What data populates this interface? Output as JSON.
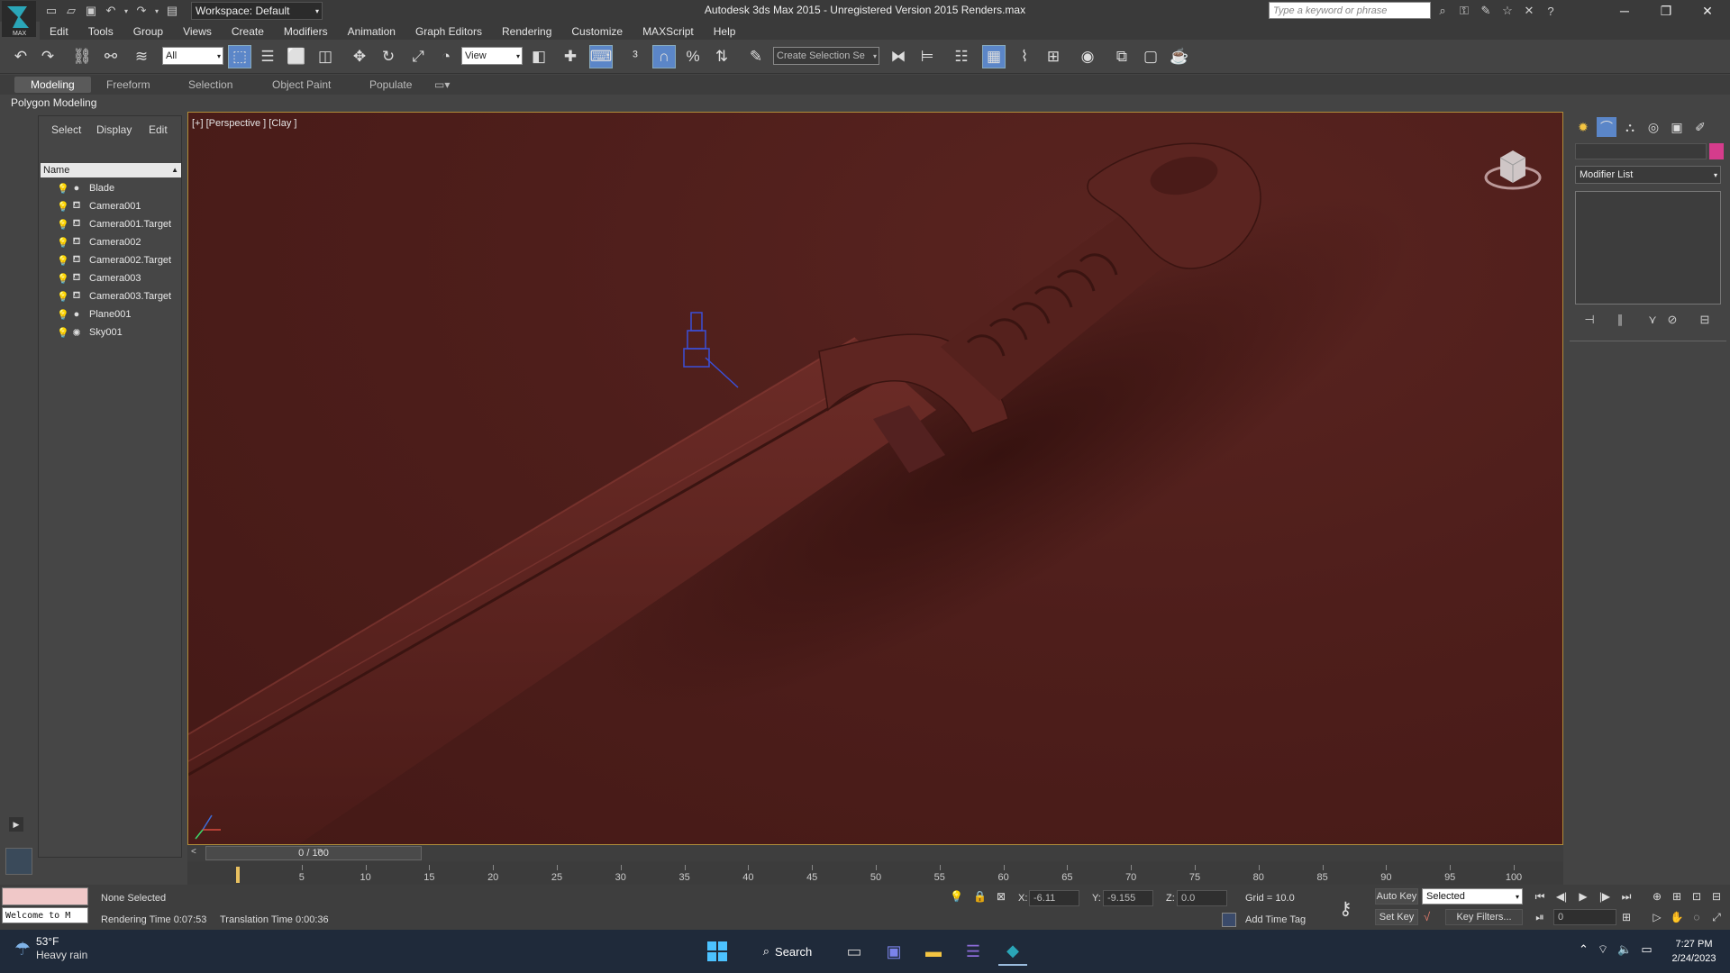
{
  "titlebar": {
    "workspace": "Workspace: Default",
    "window_title": "Autodesk 3ds Max  2015  -  Unregistered Version   2015 Renders.max",
    "search_placeholder": "Type a keyword or phrase"
  },
  "menu": [
    "Edit",
    "Tools",
    "Group",
    "Views",
    "Create",
    "Modifiers",
    "Animation",
    "Graph Editors",
    "Rendering",
    "Customize",
    "MAXScript",
    "Help"
  ],
  "toolbar": {
    "filter_value": "All",
    "reference_coord": "View",
    "selection_set": "Create Selection Se"
  },
  "ribbon": {
    "tabs": [
      "Modeling",
      "Freeform",
      "Selection",
      "Object Paint",
      "Populate"
    ],
    "sub_label": "Polygon Modeling"
  },
  "explorer": {
    "tabs": [
      "Select",
      "Display",
      "Edit"
    ],
    "column_header": "Name",
    "objects": [
      {
        "name": "Blade",
        "type": "sphere"
      },
      {
        "name": "Camera001",
        "type": "camera"
      },
      {
        "name": "Camera001.Target",
        "type": "camera"
      },
      {
        "name": "Camera002",
        "type": "camera"
      },
      {
        "name": "Camera002.Target",
        "type": "camera"
      },
      {
        "name": "Camera003",
        "type": "camera"
      },
      {
        "name": "Camera003.Target",
        "type": "camera"
      },
      {
        "name": "Plane001",
        "type": "sphere"
      },
      {
        "name": "Sky001",
        "type": "light"
      }
    ]
  },
  "viewport": {
    "label": "[+] [Perspective ] [Clay ]"
  },
  "command_panel": {
    "modifier_list": "Modifier List",
    "color": "#d53c8c"
  },
  "timeline": {
    "slider_label": "0 / 100",
    "ticks": [
      "5",
      "10",
      "15",
      "20",
      "25",
      "30",
      "35",
      "40",
      "45",
      "50",
      "55",
      "60",
      "65",
      "70",
      "75",
      "80",
      "85",
      "90",
      "95",
      "100"
    ]
  },
  "status": {
    "listener": "Welcome to M",
    "selection": "None Selected",
    "render_time": "Rendering Time  0:07:53",
    "translation_time": "Translation Time  0:00:36",
    "x_label": "X:",
    "x_value": "-6.11",
    "y_label": "Y:",
    "y_value": "-9.155",
    "z_label": "Z:",
    "z_value": "0.0",
    "grid": "Grid = 10.0",
    "add_time_tag": "Add Time Tag",
    "auto_key": "Auto Key",
    "set_key": "Set Key",
    "selected": "Selected",
    "key_filters": "Key Filters...",
    "frame": "0"
  },
  "taskbar": {
    "temp": "53°F",
    "weather": "Heavy rain",
    "search": "Search",
    "time": "7:27 PM",
    "date": "2/24/2023"
  }
}
